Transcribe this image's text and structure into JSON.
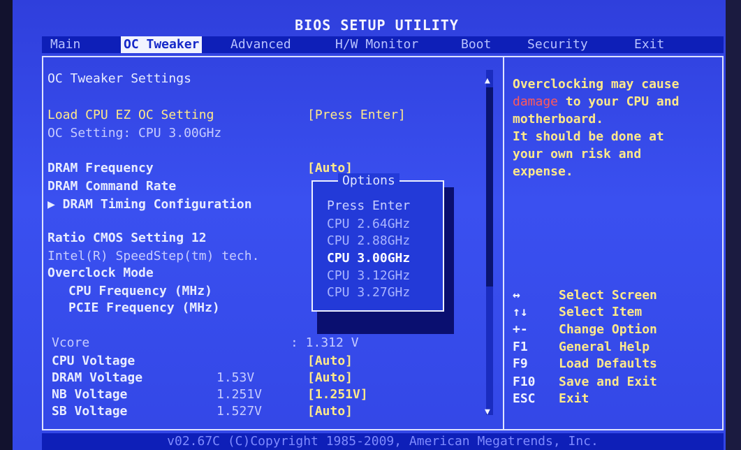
{
  "title": "BIOS SETUP UTILITY",
  "menu": [
    "Main",
    "OC Tweaker",
    "Advanced",
    "H/W Monitor",
    "Boot",
    "Security",
    "Exit"
  ],
  "active_menu": "OC Tweaker",
  "section_title": "OC Tweaker Settings",
  "settings": {
    "load_cpu_ez_oc": {
      "label": "Load CPU EZ OC Setting",
      "value": "[Press Enter]"
    },
    "oc_setting": {
      "label": "OC Setting: CPU  3.00GHz"
    },
    "dram_frequency": {
      "label": "DRAM Frequency",
      "value": "[Auto]"
    },
    "dram_command_rate": {
      "label": "DRAM Command Rate"
    },
    "dram_timing": {
      "label": "▶ DRAM Timing Configuration"
    },
    "ratio_cmos": {
      "label": "Ratio CMOS Setting  12"
    },
    "speedstep": {
      "label": "Intel(R) SpeedStep(tm) tech."
    },
    "overclock_mode": {
      "label": "Overclock Mode"
    },
    "cpu_frequency": {
      "label": "CPU Frequency (MHz)"
    },
    "pcie_frequency": {
      "label": "PCIE Frequency (MHz)"
    },
    "vcore": {
      "label": "Vcore",
      "value": ": 1.312 V"
    },
    "cpu_voltage": {
      "label": "CPU Voltage",
      "value": "[Auto]"
    },
    "dram_voltage": {
      "label": "DRAM Voltage",
      "reading": "1.53V",
      "value": "[Auto]"
    },
    "nb_voltage": {
      "label": "NB Voltage",
      "reading": "1.251V",
      "value": "[1.251V]"
    },
    "sb_voltage": {
      "label": "SB Voltage",
      "reading": "1.527V",
      "value": "[Auto]"
    }
  },
  "popup": {
    "title": "Options",
    "options": [
      "Press Enter",
      "CPU  2.64GHz",
      "CPU  2.88GHz",
      "CPU  3.00GHz",
      "CPU  3.12GHz",
      "CPU  3.27GHz"
    ],
    "selected": "CPU  3.00GHz"
  },
  "help": {
    "line1": "Overclocking may cause",
    "damage_word": "damage",
    "line2_rest": " to your CPU and",
    "line3": "motherboard.",
    "line4": "It should be done at",
    "line5": "your own risk and",
    "line6": "expense."
  },
  "keys": [
    {
      "key": "↔",
      "desc": "Select Screen"
    },
    {
      "key": "↑↓",
      "desc": "Select Item"
    },
    {
      "key": "+-",
      "desc": "Change Option"
    },
    {
      "key": "F1",
      "desc": "General Help"
    },
    {
      "key": "F9",
      "desc": "Load Defaults"
    },
    {
      "key": "F10",
      "desc": "Save and Exit"
    },
    {
      "key": "ESC",
      "desc": "Exit"
    }
  ],
  "footer": "v02.67C (C)Copyright 1985-2009, American Megatrends, Inc."
}
